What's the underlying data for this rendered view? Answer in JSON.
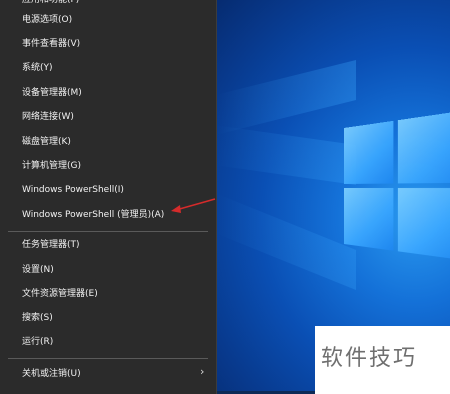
{
  "menu": {
    "items": [
      {
        "label": "应用和功能(F)"
      },
      {
        "label": "电源选项(O)"
      },
      {
        "label": "事件查看器(V)"
      },
      {
        "label": "系统(Y)"
      },
      {
        "label": "设备管理器(M)"
      },
      {
        "label": "网络连接(W)"
      },
      {
        "label": "磁盘管理(K)"
      },
      {
        "label": "计算机管理(G)"
      },
      {
        "label": "Windows PowerShell(I)"
      },
      {
        "label": "Windows PowerShell (管理员)(A)"
      },
      {
        "label": "任务管理器(T)"
      },
      {
        "label": "设置(N)"
      },
      {
        "label": "文件资源管理器(E)"
      },
      {
        "label": "搜索(S)"
      },
      {
        "label": "运行(R)"
      },
      {
        "label": "关机或注销(U)"
      }
    ],
    "submenu_arrow": "›"
  },
  "watermark": {
    "text": "软件技巧"
  },
  "colors": {
    "menu_bg": "#2b2b2b",
    "annotation": "#d42b2b",
    "desktop": "#0a4fb4"
  }
}
